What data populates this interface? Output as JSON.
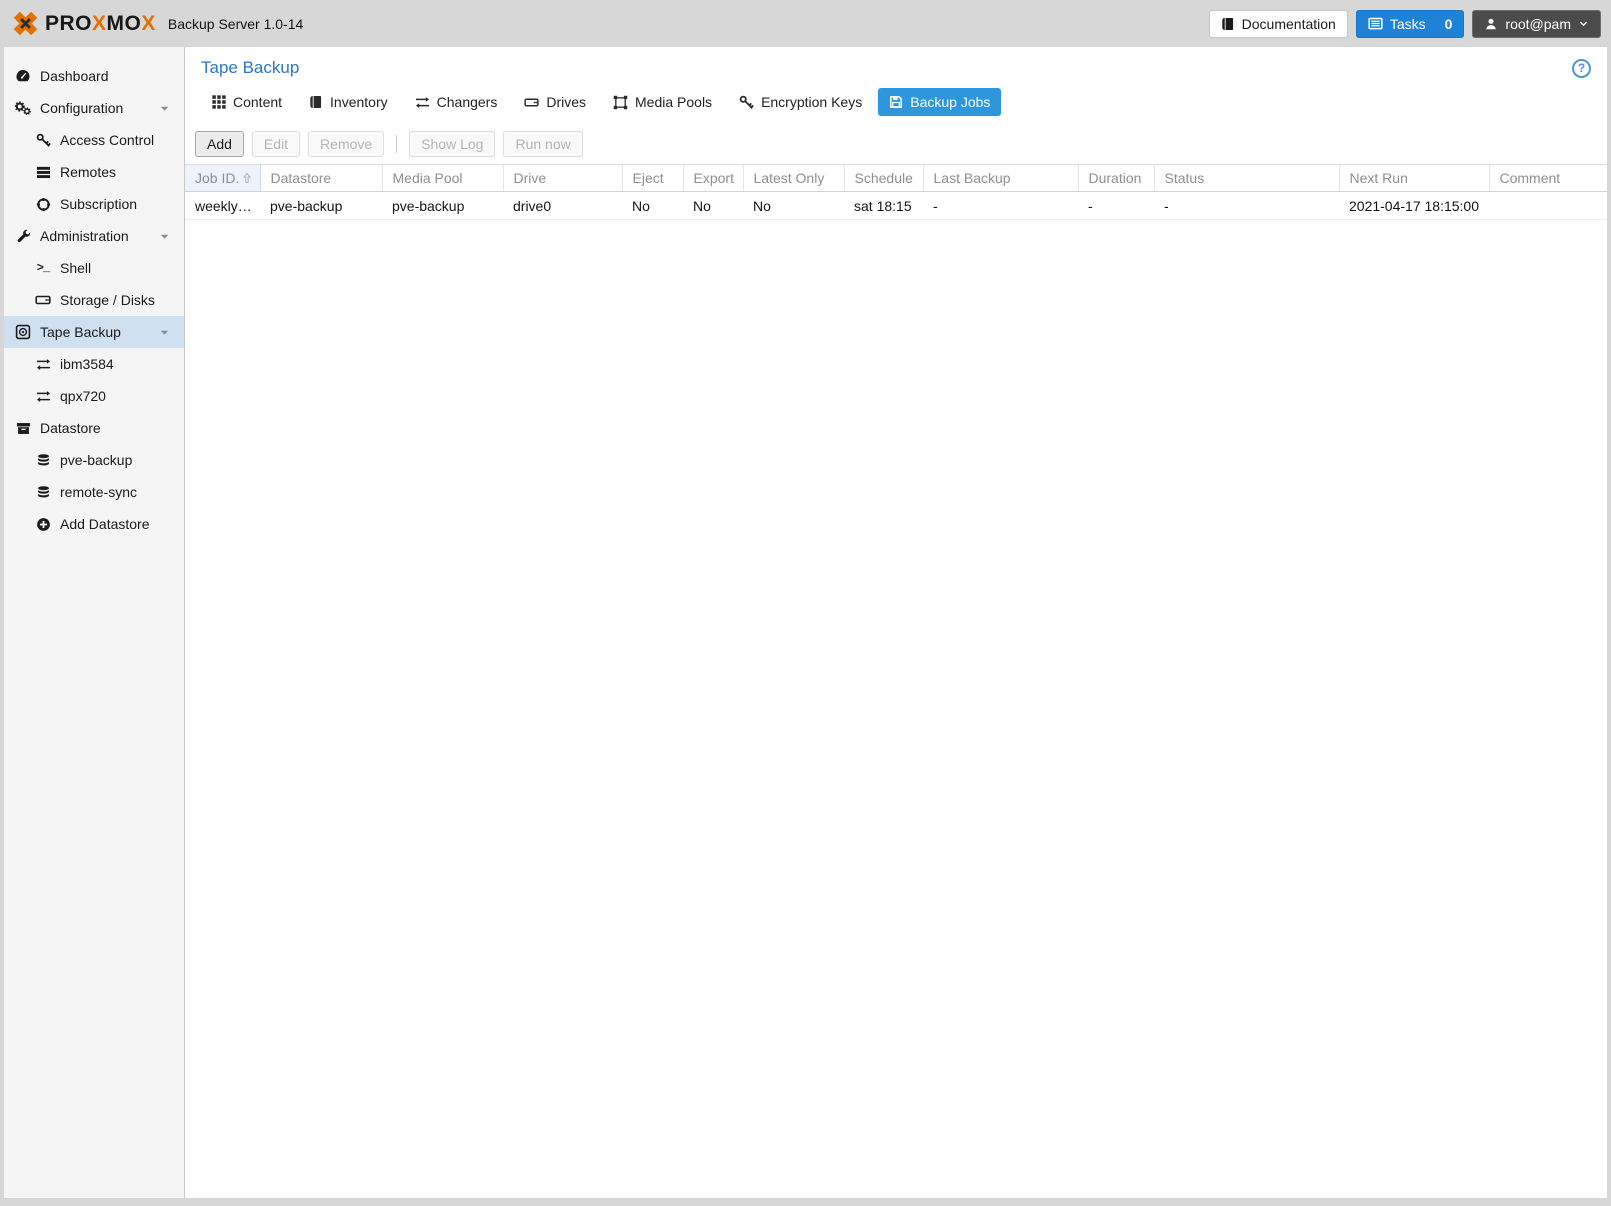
{
  "header": {
    "brand_p1": "PRO",
    "brand_x1": "X",
    "brand_p2": "MO",
    "brand_x2": "X",
    "subtitle": "Backup Server 1.0-14",
    "documentation_label": "Documentation",
    "tasks_label": "Tasks",
    "tasks_count": "0",
    "user_label": "root@pam"
  },
  "sidebar": {
    "items": [
      {
        "label": "Dashboard"
      },
      {
        "label": "Configuration"
      },
      {
        "label": "Access Control"
      },
      {
        "label": "Remotes"
      },
      {
        "label": "Subscription"
      },
      {
        "label": "Administration"
      },
      {
        "label": "Shell"
      },
      {
        "label": "Storage / Disks"
      },
      {
        "label": "Tape Backup",
        "selected": true
      },
      {
        "label": "ibm3584"
      },
      {
        "label": "qpx720"
      },
      {
        "label": "Datastore"
      },
      {
        "label": "pve-backup"
      },
      {
        "label": "remote-sync"
      },
      {
        "label": "Add Datastore"
      }
    ]
  },
  "main": {
    "title": "Tape Backup",
    "help_label": "?",
    "tabs": [
      {
        "label": "Content"
      },
      {
        "label": "Inventory"
      },
      {
        "label": "Changers"
      },
      {
        "label": "Drives"
      },
      {
        "label": "Media Pools"
      },
      {
        "label": "Encryption Keys"
      },
      {
        "label": "Backup Jobs",
        "active": true
      }
    ],
    "toolbar": {
      "add": "Add",
      "edit": "Edit",
      "remove": "Remove",
      "show_log": "Show Log",
      "run_now": "Run now"
    },
    "table": {
      "columns": [
        "Job ID.",
        "Datastore",
        "Media Pool",
        "Drive",
        "Eject",
        "Export",
        "Latest Only",
        "Schedule",
        "Last Backup",
        "Duration",
        "Status",
        "Next Run",
        "Comment"
      ],
      "rows": [
        [
          "weekly…",
          "pve-backup",
          "pve-backup",
          "drive0",
          "No",
          "No",
          "No",
          "sat 18:15",
          "-",
          "-",
          "-",
          "2021-04-17 18:15:00",
          ""
        ]
      ]
    }
  },
  "colors": {
    "accent_blue": "#2e96dc",
    "tasks_blue": "#1e82d6",
    "brand_orange": "#e57000",
    "selected_row_bg": "#cfe0f1",
    "title_blue": "#2878c8"
  }
}
